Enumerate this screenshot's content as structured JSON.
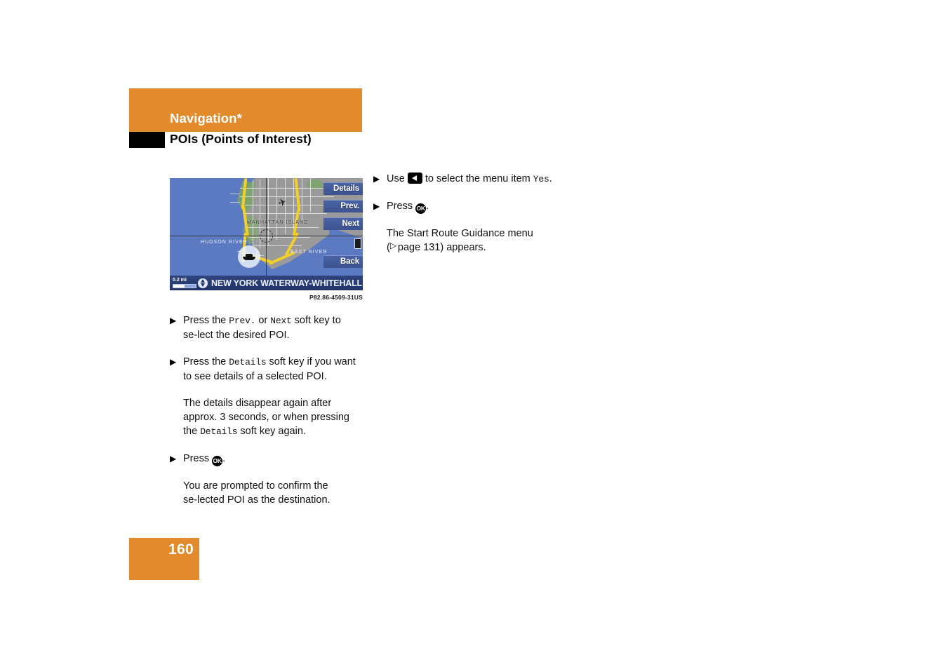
{
  "header": {
    "chapter": "Navigation*",
    "section": "POIs (Points of Interest)",
    "band_color": "#e28a2c",
    "tab_color": "#000000"
  },
  "figure": {
    "caption": "P82.86-4509-31US",
    "map": {
      "softkeys": [
        {
          "label": "Details"
        },
        {
          "label": "Prev."
        },
        {
          "label": "Next"
        },
        {
          "label": "Back"
        }
      ],
      "labels": {
        "manhattan": "MANHATTAN ISLAND",
        "hudson": "HUDSON RIVER",
        "east": "EAST RIVER"
      },
      "status_bar": {
        "scale": "0.2 mi",
        "poi_name": "NEW YORK WATERWAY-WHITEHALL ST"
      }
    }
  },
  "left_column": {
    "steps": [
      {
        "bullet": "▶",
        "parts": [
          {
            "t": "Press the ",
            "mono": false
          },
          {
            "t": "Prev.",
            "mono": true
          },
          {
            "t": " or ",
            "mono": false
          },
          {
            "t": "Next",
            "mono": true
          },
          {
            "t": " soft key to se‑lect the desired POI.",
            "mono": false
          }
        ]
      },
      {
        "bullet": "▶",
        "parts": [
          {
            "t": "Press the ",
            "mono": false
          },
          {
            "t": "Details",
            "mono": true
          },
          {
            "t": " soft key if you want to see details of a selected POI.",
            "mono": false
          }
        ]
      }
    ],
    "para_details": {
      "pre": "The details disappear again after approx. 3 seconds, or when pressing the ",
      "mono": "Details",
      "post": " soft key again."
    },
    "press_ok": {
      "bullet": "▶",
      "pre": "Press ",
      "key": "OK",
      "post": "."
    },
    "para_confirm": "You are prompted to confirm the se‑lected POI as the destination."
  },
  "right_column": {
    "step_use": {
      "bullet": "▶",
      "pre": "Use ",
      "key": "left-arrow",
      "mid": " to select the menu item ",
      "mono": "Yes",
      "post": "."
    },
    "step_press": {
      "bullet": "▶",
      "pre": "Press ",
      "key": "OK",
      "post": "."
    },
    "para_result_line1": "The Start Route Guidance menu",
    "para_result_line2_pre": "(",
    "para_result_line2_ref": "page 131",
    "para_result_line2_post": ") appears."
  },
  "footer": {
    "page_number": "160",
    "box_color": "#e28a2c"
  }
}
